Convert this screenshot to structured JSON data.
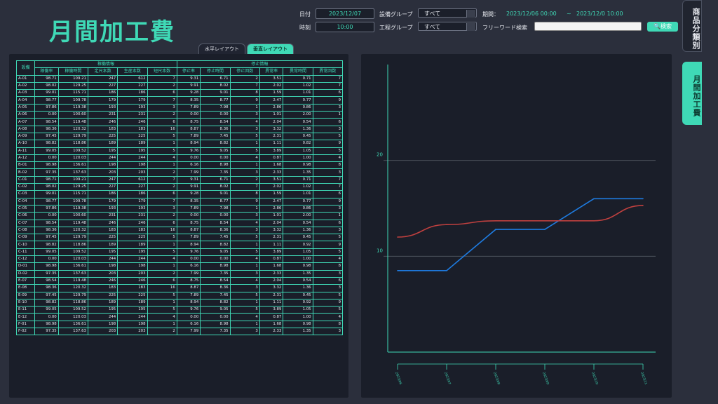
{
  "title": "月間加工費",
  "header": {
    "date_label": "日付",
    "date_value": "2023/12/07",
    "time_label": "時刻",
    "time_value": "10:00",
    "equip_group_label": "設備グループ",
    "equip_group_value": "すべて",
    "process_group_label": "工程グループ",
    "process_group_value": "すべて",
    "period_label": "期間：",
    "period_start": "2023/12/06 00:00",
    "period_sep": "~",
    "period_end": "2023/12/0 10:00",
    "freeword_label": "フリーワード検索",
    "freeword_value": "",
    "search_button": "🔍検索"
  },
  "layout_tabs": [
    "水平レイアウト",
    "垂直レイアウト"
  ],
  "side_tabs": [
    "商品分類別",
    "月間加工費"
  ],
  "table": {
    "group_running": "稼働情報",
    "group_stop": "停止情報",
    "columns": [
      "設備",
      "稼働率",
      "稼働時間",
      "定尺本数",
      "生産本数",
      "短尺本数",
      "停止率",
      "停止時間",
      "停止回数",
      "異常率",
      "異常時間",
      "異常回数"
    ],
    "rows": [
      [
        "A-01",
        "98.71",
        "109.21",
        "247",
        "612",
        "7",
        "9.31",
        "6.71",
        "2",
        "3.51",
        "0.71",
        "7"
      ],
      [
        "A-02",
        "98.02",
        "129.25",
        "227",
        "227",
        "2",
        "9.91",
        "8.02",
        "7",
        "2.02",
        "1.02",
        "7"
      ],
      [
        "A-03",
        "99.01",
        "115.71",
        "186",
        "186",
        "6",
        "9.28",
        "9.01",
        "8",
        "1.59",
        "1.01",
        "6"
      ],
      [
        "A-04",
        "98.77",
        "109.78",
        "179",
        "179",
        "7",
        "8.35",
        "8.77",
        "9",
        "2.47",
        "0.77",
        "9"
      ],
      [
        "A-05",
        "97.86",
        "119.38",
        "193",
        "193",
        "3",
        "7.89",
        "7.98",
        "1",
        "2.86",
        "0.86",
        "3"
      ],
      [
        "A-06",
        "0.00",
        "100.60",
        "231",
        "231",
        "2",
        "0.00",
        "0.00",
        "3",
        "1.01",
        "2.00",
        "1"
      ],
      [
        "A-07",
        "98.54",
        "119.48",
        "246",
        "246",
        "6",
        "8.75",
        "8.54",
        "4",
        "2.04",
        "0.54",
        "6"
      ],
      [
        "A-08",
        "98.36",
        "120.32",
        "183",
        "183",
        "16",
        "8.87",
        "8.36",
        "3",
        "3.32",
        "1.36",
        "3"
      ],
      [
        "A-09",
        "97.45",
        "129.79",
        "225",
        "225",
        "5",
        "7.89",
        "7.45",
        "5",
        "2.31",
        "0.45",
        "5"
      ],
      [
        "A-10",
        "98.82",
        "118.86",
        "189",
        "189",
        "1",
        "8.94",
        "8.82",
        "1",
        "1.11",
        "0.82",
        "9"
      ],
      [
        "A-11",
        "99.05",
        "109.52",
        "195",
        "195",
        "5",
        "9.76",
        "9.05",
        "5",
        "3.89",
        "1.05",
        "5"
      ],
      [
        "A-12",
        "0.00",
        "120.03",
        "244",
        "244",
        "4",
        "0.00",
        "0.00",
        "4",
        "0.87",
        "1.00",
        "4"
      ],
      [
        "B-01",
        "98.98",
        "136.61",
        "198",
        "198",
        "1",
        "6.16",
        "8.98",
        "1",
        "1.68",
        "0.98",
        "8"
      ],
      [
        "B-02",
        "97.35",
        "137.63",
        "203",
        "203",
        "2",
        "7.99",
        "7.35",
        "3",
        "2.33",
        "1.35",
        "3"
      ],
      [
        "C-01",
        "98.71",
        "109.21",
        "247",
        "612",
        "7",
        "9.31",
        "6.71",
        "2",
        "3.51",
        "0.71",
        "7"
      ],
      [
        "C-02",
        "98.02",
        "129.25",
        "227",
        "227",
        "2",
        "9.91",
        "8.02",
        "7",
        "2.02",
        "1.02",
        "7"
      ],
      [
        "C-03",
        "99.01",
        "115.71",
        "186",
        "186",
        "6",
        "9.28",
        "9.01",
        "8",
        "1.59",
        "1.01",
        "6"
      ],
      [
        "C-04",
        "98.77",
        "109.78",
        "179",
        "179",
        "7",
        "8.35",
        "8.77",
        "9",
        "2.47",
        "0.77",
        "9"
      ],
      [
        "C-05",
        "97.86",
        "119.38",
        "193",
        "193",
        "3",
        "7.89",
        "7.98",
        "1",
        "2.86",
        "0.86",
        "3"
      ],
      [
        "C-06",
        "0.00",
        "100.60",
        "231",
        "231",
        "2",
        "0.00",
        "0.00",
        "3",
        "1.01",
        "2.00",
        "1"
      ],
      [
        "C-07",
        "98.54",
        "119.48",
        "246",
        "246",
        "6",
        "8.75",
        "8.54",
        "4",
        "2.04",
        "0.54",
        "6"
      ],
      [
        "C-08",
        "98.36",
        "120.32",
        "183",
        "183",
        "16",
        "8.87",
        "8.36",
        "3",
        "3.32",
        "1.36",
        "3"
      ],
      [
        "C-09",
        "97.45",
        "129.79",
        "225",
        "225",
        "5",
        "7.89",
        "7.45",
        "5",
        "2.31",
        "0.45",
        "5"
      ],
      [
        "C-10",
        "98.82",
        "118.86",
        "189",
        "189",
        "1",
        "8.94",
        "8.82",
        "1",
        "1.11",
        "0.92",
        "9"
      ],
      [
        "C-11",
        "99.05",
        "109.52",
        "195",
        "195",
        "5",
        "9.76",
        "9.05",
        "5",
        "3.89",
        "1.05",
        "5"
      ],
      [
        "C-12",
        "0.00",
        "120.03",
        "244",
        "244",
        "4",
        "0.00",
        "0.00",
        "4",
        "0.87",
        "1.00",
        "4"
      ],
      [
        "D-01",
        "98.98",
        "136.61",
        "198",
        "198",
        "1",
        "6.16",
        "8.98",
        "1",
        "1.68",
        "0.98",
        "8"
      ],
      [
        "D-02",
        "97.35",
        "137.63",
        "203",
        "203",
        "2",
        "7.99",
        "7.35",
        "3",
        "2.33",
        "1.35",
        "3"
      ],
      [
        "E-07",
        "98.54",
        "119.48",
        "246",
        "246",
        "6",
        "8.75",
        "8.54",
        "4",
        "2.04",
        "0.54",
        "6"
      ],
      [
        "E-08",
        "98.36",
        "120.32",
        "183",
        "183",
        "16",
        "8.87",
        "8.36",
        "3",
        "3.32",
        "1.36",
        "3"
      ],
      [
        "E-09",
        "97.45",
        "129.79",
        "225",
        "225",
        "5",
        "7.89",
        "7.45",
        "5",
        "2.31",
        "0.45",
        "5"
      ],
      [
        "E-10",
        "98.82",
        "118.86",
        "189",
        "189",
        "1",
        "8.94",
        "8.82",
        "1",
        "1.11",
        "0.92",
        "9"
      ],
      [
        "E-11",
        "99.05",
        "109.52",
        "195",
        "195",
        "5",
        "9.76",
        "9.05",
        "5",
        "3.89",
        "1.05",
        "5"
      ],
      [
        "E-12",
        "0.00",
        "120.03",
        "244",
        "244",
        "4",
        "0.00",
        "0.00",
        "4",
        "0.87",
        "1.00",
        "4"
      ],
      [
        "F-01",
        "98.98",
        "136.61",
        "198",
        "198",
        "1",
        "6.16",
        "8.98",
        "1",
        "1.68",
        "0.98",
        "8"
      ],
      [
        "F-02",
        "97.35",
        "137.63",
        "203",
        "203",
        "2",
        "7.99",
        "7.35",
        "3",
        "2.33",
        "1.35",
        "3"
      ]
    ]
  },
  "chart_data": {
    "type": "line",
    "title": "",
    "xlabel": "",
    "ylabel": "",
    "y_ticks": [
      "20",
      "10"
    ],
    "ylim": [
      0,
      30
    ],
    "x": [
      "2023/06",
      "2023/07",
      "2023/08",
      "2023/09",
      "2023/10",
      "2023/11"
    ],
    "series": [
      {
        "color": "#1e7be0",
        "values": [
          8.5,
          8.5,
          12.8,
          12.8,
          16.0,
          16.0
        ]
      },
      {
        "color": "#c0403f",
        "values": [
          12.0,
          13.3,
          13.7,
          13.7,
          13.7,
          15.3
        ]
      }
    ],
    "grid": true,
    "legend": "none"
  },
  "colors": {
    "accent": "#3fd9b6",
    "background": "#2b2f3c",
    "panel": "#1a1e29"
  }
}
